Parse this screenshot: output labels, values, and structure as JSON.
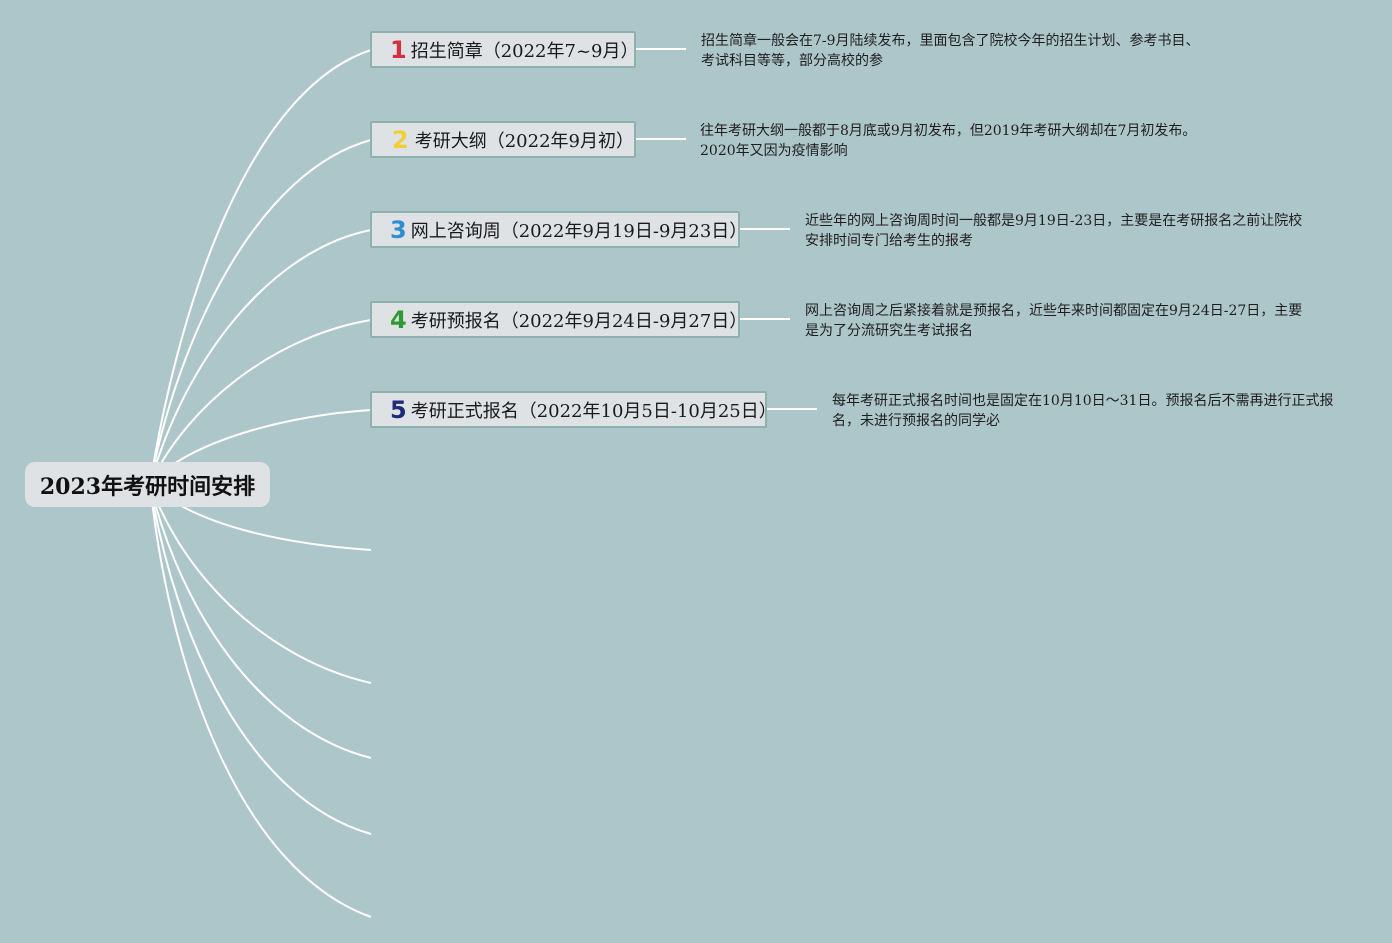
{
  "title": "2023年考研时间安排",
  "branches": [
    {
      "num": "1",
      "label": "招生简章（2022年7~9月）",
      "color": "#d6303f",
      "note_line1": "招生简章一般会在7-9月陆续发布，里面包含了院校今年的招生计划、参考书目、",
      "note_line2": "考试科目等等，部分高校的参"
    },
    {
      "num": "2",
      "label": "考研大纲（2022年9月初）",
      "color": "#f2cf3a",
      "note_line1": "往年考研大纲一般都于8月底或9月初发布，但2019年考研大纲却在7月初发布。",
      "note_line2": "2020年又因为疫情影响"
    },
    {
      "num": "3",
      "label": "网上咨询周（2022年9月19日-9月23日）",
      "color": "#2e8fd0",
      "note_line1": "近些年的网上咨询周时间一般都是9月19日-23日，主要是在考研报名之前让院校",
      "note_line2": "安排时间专门给考生的报考"
    },
    {
      "num": "4",
      "label": "考研预报名（2022年9月24日-9月27日）",
      "color": "#2f9a33",
      "note_line1": "网上咨询周之后紧接着就是预报名，近些年来时间都固定在9月24日-27日，主要",
      "note_line2": "是为了分流研究生考试报名"
    },
    {
      "num": "5",
      "label": "考研正式报名（2022年10月5日-10月25日）",
      "color": "#1f2a78",
      "note_line1": "每年考研正式报名时间也是固定在10月10日～31日。预报名后不需再进行正式报",
      "note_line2": "名，未进行预报名的同学必"
    }
  ],
  "line_color": "#ffffff"
}
